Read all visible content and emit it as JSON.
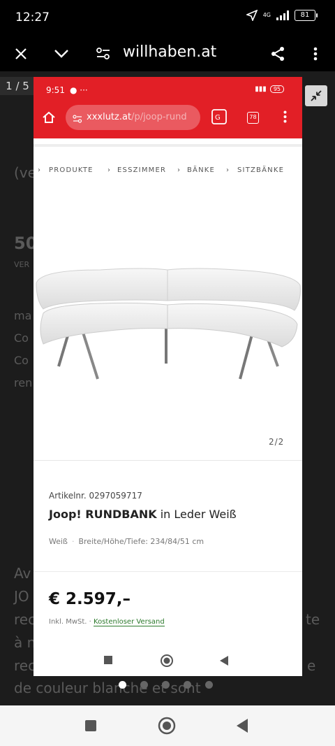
{
  "status_bar": {
    "time": "12:27",
    "network": "4G",
    "battery": "81"
  },
  "top_bar": {
    "domain": "willhaben.at",
    "icons": [
      "close-icon",
      "chevron-down-icon",
      "site-settings-icon",
      "share-icon",
      "more-vert-icon"
    ]
  },
  "gallery": {
    "counter": "1 / 5",
    "active_index": 0,
    "dot_count": 5
  },
  "background_text": {
    "line1": "(ve",
    "line2": "50",
    "line3": "VER",
    "line4": "ma",
    "line5": "Co",
    "line6": "Co",
    "line7": "ren",
    "para1": "Av",
    "para2": "JO",
    "para3": "rec",
    "para4": "te",
    "para5": "à n",
    "para6": "rec",
    "para7": "e",
    "para8": "de couleur blanche et sont"
  },
  "inner": {
    "status": {
      "time": "9:51",
      "battery": "95"
    },
    "url": {
      "host": "xxxlutz.at",
      "path": "/p/joop-rund"
    },
    "tabs_count": "78",
    "breadcrumb": [
      "PRODUKTE",
      "ESSZIMMER",
      "BÄNKE",
      "SITZBÄNKE"
    ],
    "image_counter": "2/2",
    "product": {
      "article_number": "Artikelnr. 0297059717",
      "brand_name": "Joop! RUNDBANK",
      "title_rest": " in Leder Weiß",
      "color": "Weiß",
      "dimensions": "Breite/Höhe/Tiefe: 234/84/51 cm",
      "price": "€ 2.597,–",
      "vat": "Inkl. MwSt. ·",
      "shipping": "Kostenloser Versand"
    }
  },
  "colors": {
    "brand_red": "#e21f26",
    "shipping_green": "#2d7a2d"
  }
}
